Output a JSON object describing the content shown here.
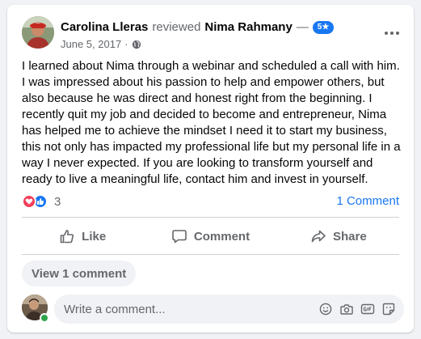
{
  "review": {
    "author": "Carolina Lleras",
    "verb": "reviewed",
    "target": "Nima Rahmany",
    "dash": "—",
    "rating_badge": "5★",
    "date": "June 5, 2017",
    "separator": "·",
    "privacy_icon": "globe-icon",
    "text": "I learned about Nima through a webinar and scheduled a call with him. I was impressed about his passion to help and empower others, but also because he was direct and honest right from the beginning. I recently quit my job and decided to become and entrepreneur, Nima has helped me to achieve the mindset I need it to start my business, this not only has impacted my professional life but my personal life in a way I never expected. If you are looking to transform yourself and ready to live a meaningful life, contact him and invest in yourself."
  },
  "reactions": {
    "icons": [
      "love-icon",
      "like-icon"
    ],
    "count": "3",
    "comments_link": "1 Comment"
  },
  "actions": {
    "like": "Like",
    "comment": "Comment",
    "share": "Share"
  },
  "comments": {
    "view_label": "View 1 comment",
    "placeholder": "Write a comment...",
    "tools": [
      "emoji-icon",
      "camera-icon",
      "gif-icon",
      "sticker-icon"
    ]
  },
  "colors": {
    "accent": "#1877f2",
    "love": "#f33e58",
    "muted_text": "#65676b",
    "online": "#31a24c"
  }
}
